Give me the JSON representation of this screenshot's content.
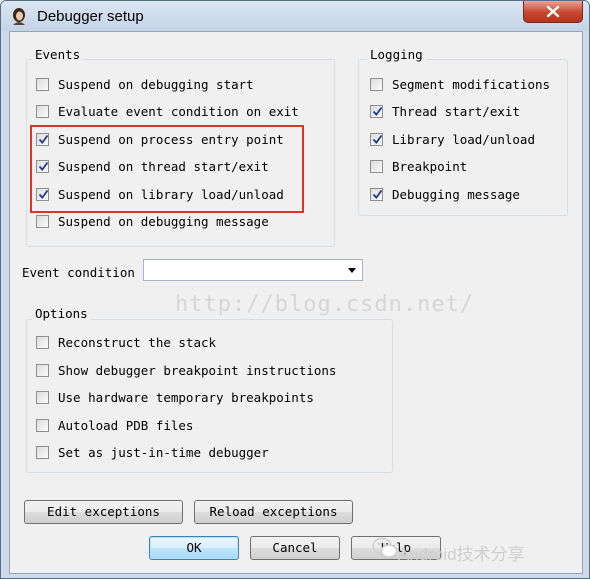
{
  "window": {
    "title": "Debugger setup",
    "icon": "app-icon"
  },
  "events": {
    "title": "Events",
    "items": [
      {
        "label": "Suspend on debugging start",
        "checked": false
      },
      {
        "label": "Evaluate event condition on exit",
        "checked": false
      },
      {
        "label": "Suspend on process entry point",
        "checked": true
      },
      {
        "label": "Suspend on thread start/exit",
        "checked": true
      },
      {
        "label": "Suspend on library load/unload",
        "checked": true
      },
      {
        "label": "Suspend on debugging message",
        "checked": false
      }
    ]
  },
  "logging": {
    "title": "Logging",
    "items": [
      {
        "label": "Segment modifications",
        "checked": false
      },
      {
        "label": "Thread start/exit",
        "checked": true
      },
      {
        "label": "Library load/unload",
        "checked": true
      },
      {
        "label": "Breakpoint",
        "checked": false
      },
      {
        "label": "Debugging message",
        "checked": true
      }
    ]
  },
  "event_condition": {
    "label": "Event condition",
    "value": ""
  },
  "options": {
    "title": "Options",
    "items": [
      {
        "label": "Reconstruct the stack",
        "checked": false
      },
      {
        "label": "Show debugger breakpoint instructions",
        "checked": false
      },
      {
        "label": "Use hardware temporary breakpoints",
        "checked": false
      },
      {
        "label": "Autoload PDB files",
        "checked": false
      },
      {
        "label": "Set as just-in-time debugger",
        "checked": false
      }
    ]
  },
  "buttons": {
    "edit_exceptions": "Edit exceptions",
    "reload_exceptions": "Reload exceptions",
    "ok": "OK",
    "cancel": "Cancel",
    "help": "Help"
  },
  "watermarks": {
    "url": "http://blog.csdn.net/",
    "brand": "Android技术分享"
  },
  "colors": {
    "highlight": "#e0322b",
    "close_button": "#c6472f"
  }
}
